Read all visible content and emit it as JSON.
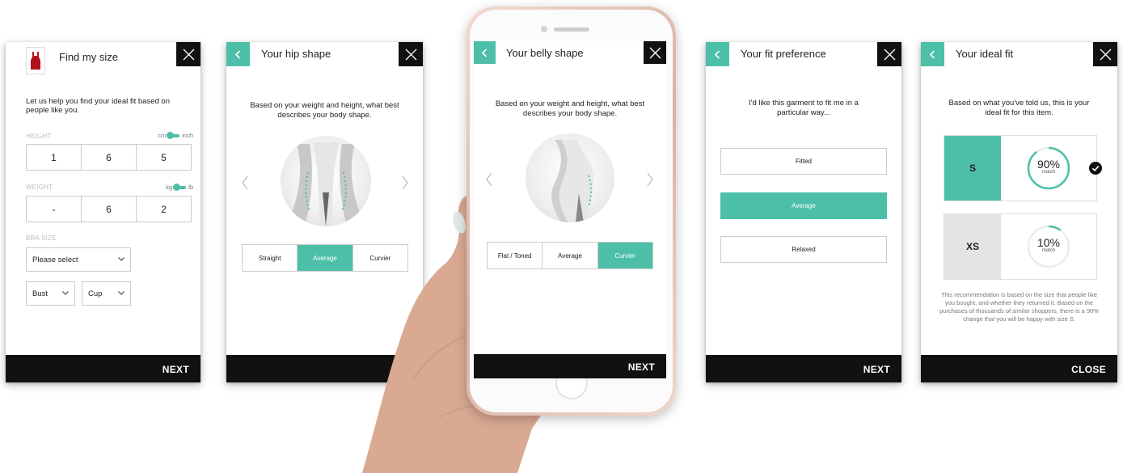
{
  "colors": {
    "accent": "#4dbfa8",
    "dark": "#111111"
  },
  "icons": {
    "close": "close-x-icon",
    "back": "chevron-left-icon",
    "dropdown": "chevron-down-icon",
    "garment": "red-tank-top-icon",
    "check": "check-circle-icon"
  },
  "screen1": {
    "title": "Find my size",
    "intro": "Let us help you find your ideal fit based on people like you.",
    "height_label": "HEIGHT",
    "height_unit_left": "cm",
    "height_unit_right": "inch",
    "height_values": [
      "1",
      "6",
      "5"
    ],
    "weight_label": "WEIGHT",
    "weight_unit_left": "kg",
    "weight_unit_right": "lb",
    "weight_values": [
      "-",
      "6",
      "2"
    ],
    "bra_label": "BRA SIZE",
    "bra_select": "Please select",
    "bust_select": "Bust",
    "cup_select": "Cup",
    "next": "NEXT"
  },
  "screen2": {
    "title": "Your hip shape",
    "desc": "Based on your weight and height, what best describes your body shape.",
    "options": [
      "Straight",
      "Average",
      "Curvier"
    ],
    "selected": "Average"
  },
  "screen3": {
    "title": "Your belly shape",
    "desc": "Based on your weight and height, what best describes your body shape.",
    "options": [
      "Flat / Toned",
      "Average",
      "Curvier"
    ],
    "selected": "Curvier",
    "next": "NEXT"
  },
  "screen4": {
    "title": "Your fit preference",
    "desc": "I'd like this garment to fit me in a particular way...",
    "options": [
      "Fitted",
      "Average",
      "Relaxed"
    ],
    "selected": "Average",
    "next": "NEXT"
  },
  "screen5": {
    "title": "Your ideal fit",
    "desc": "Based on what you've told us, this is your ideal fit for this item.",
    "results": [
      {
        "size": "S",
        "percent": "90%",
        "match": "match",
        "value": 0.9
      },
      {
        "size": "XS",
        "percent": "10%",
        "match": "match",
        "value": 0.1
      }
    ],
    "note": "This recommendation is based on the size that people like you bought, and whether they returned it. Based on the purchases of thousands of similar shoppers, there is a 90% change that you will be happy with size S.",
    "close": "CLOSE"
  }
}
